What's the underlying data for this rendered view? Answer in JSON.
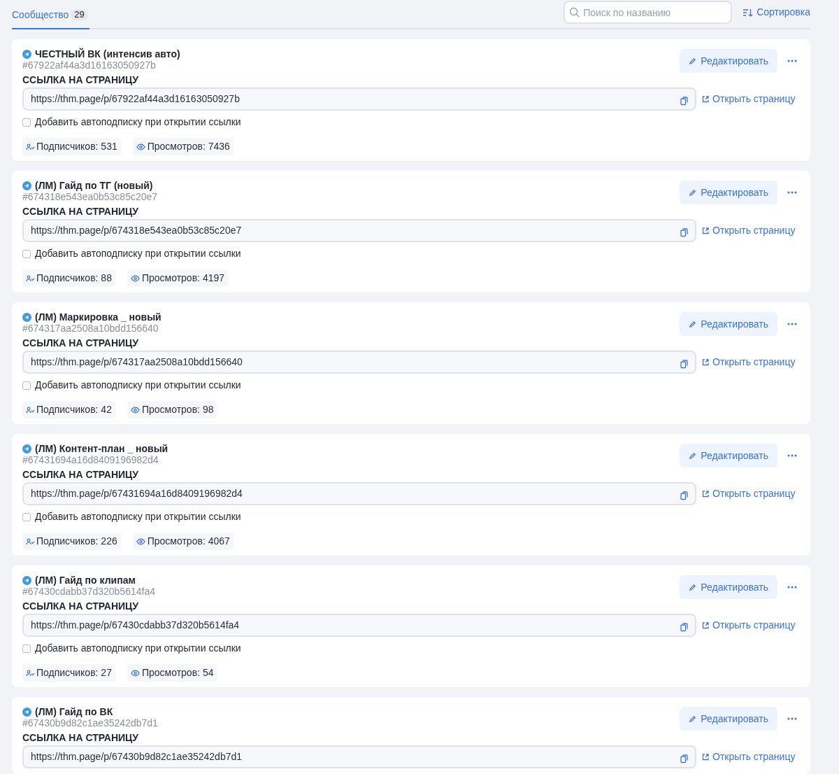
{
  "tabs": [
    {
      "label": "Сообщество",
      "count": "29",
      "selected": true
    }
  ],
  "search": {
    "placeholder": "Поиск по названию"
  },
  "sort_button": "Сортировка",
  "pages": [
    {
      "title": "ЧЕСТНЫЙ ВК (интенсив авто)",
      "id": "#67922af44a3d16163050927b",
      "edit": "Редактировать",
      "link_label": "ССЫЛКА НА СТРАНИЦУ",
      "url": "https://thm.page/p/67922af44a3d16163050927b",
      "open": "Открыть страницу",
      "autosub": {
        "label": "Добавить автоподписку при открытии ссылки",
        "checked": false
      },
      "subscribers": "Подписчиков: 531",
      "views": "Просмотров: 7436"
    },
    {
      "title": "(ЛМ) Гайд по ТГ (новый)",
      "id": "#674318e543ea0b53c85c20e7",
      "edit": "Редактировать",
      "link_label": "ССЫЛКА НА СТРАНИЦУ",
      "url": "https://thm.page/p/674318e543ea0b53c85c20e7",
      "open": "Открыть страницу",
      "autosub": {
        "label": "Добавить автоподписку при открытии ссылки",
        "checked": false
      },
      "subscribers": "Подписчиков: 88",
      "views": "Просмотров: 4197"
    },
    {
      "title": "(ЛМ) Маркировка _ новый",
      "id": "#674317aa2508a10bdd156640",
      "edit": "Редактировать",
      "link_label": "ССЫЛКА НА СТРАНИЦУ",
      "url": "https://thm.page/p/674317aa2508a10bdd156640",
      "open": "Открыть страницу",
      "autosub": {
        "label": "Добавить автоподписку при открытии ссылки",
        "checked": false
      },
      "subscribers": "Подписчиков: 42",
      "views": "Просмотров: 98"
    },
    {
      "title": "(ЛМ) Контент-план _ новый",
      "id": "#67431694a16d8409196982d4",
      "edit": "Редактировать",
      "link_label": "ССЫЛКА НА СТРАНИЦУ",
      "url": "https://thm.page/p/67431694a16d8409196982d4",
      "open": "Открыть страницу",
      "autosub": {
        "label": "Добавить автоподписку при открытии ссылки",
        "checked": false
      },
      "subscribers": "Подписчиков: 226",
      "views": "Просмотров: 4067"
    },
    {
      "title": "(ЛМ) Гайд по клипам",
      "id": "#67430cdabb37d320b5614fa4",
      "edit": "Редактировать",
      "link_label": "ССЫЛКА НА СТРАНИЦУ",
      "url": "https://thm.page/p/67430cdabb37d320b5614fa4",
      "open": "Открыть страницу",
      "autosub": {
        "label": "Добавить автоподписку при открытии ссылки",
        "checked": false
      },
      "subscribers": "Подписчиков: 27",
      "views": "Просмотров: 54"
    },
    {
      "title": "(ЛМ) Гайд по ВК",
      "id": "#67430b9d82c1ae35242db7d1",
      "edit": "Редактировать",
      "link_label": "ССЫЛКА НА СТРАНИЦУ",
      "url": "https://thm.page/p/67430b9d82c1ae35242db7d1",
      "open": "Открыть страницу"
    }
  ]
}
